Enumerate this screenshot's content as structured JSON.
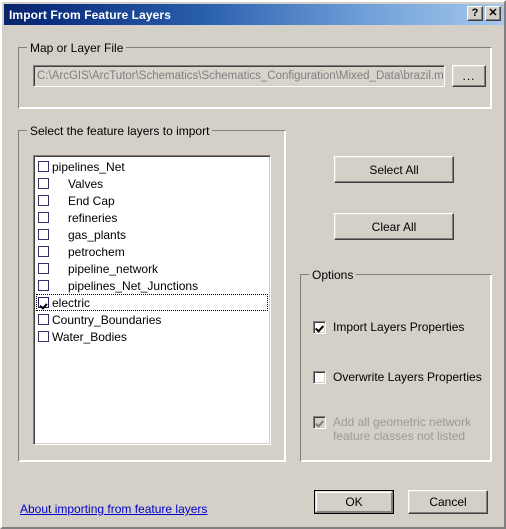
{
  "window": {
    "title": "Import From Feature Layers",
    "help_button": "?",
    "close_button": "✕"
  },
  "map_group": {
    "legend": "Map or Layer File",
    "path_value": "C:\\ArcGIS\\ArcTutor\\Schematics\\Schematics_Configuration\\Mixed_Data\\brazil.mxd",
    "browse_label": "..."
  },
  "layers_group": {
    "legend": "Select the feature layers to import",
    "items": [
      {
        "label": "pipelines_Net",
        "checked": false,
        "indent": false,
        "focused": false
      },
      {
        "label": "Valves",
        "checked": false,
        "indent": true,
        "focused": false
      },
      {
        "label": "End Cap",
        "checked": false,
        "indent": true,
        "focused": false
      },
      {
        "label": "refineries",
        "checked": false,
        "indent": true,
        "focused": false
      },
      {
        "label": "gas_plants",
        "checked": false,
        "indent": true,
        "focused": false
      },
      {
        "label": "petrochem",
        "checked": false,
        "indent": true,
        "focused": false
      },
      {
        "label": "pipeline_network",
        "checked": false,
        "indent": true,
        "focused": false
      },
      {
        "label": "pipelines_Net_Junctions",
        "checked": false,
        "indent": true,
        "focused": false
      },
      {
        "label": "electric",
        "checked": true,
        "indent": false,
        "focused": true
      },
      {
        "label": "Country_Boundaries",
        "checked": false,
        "indent": false,
        "focused": false
      },
      {
        "label": "Water_Bodies",
        "checked": false,
        "indent": false,
        "focused": false
      }
    ]
  },
  "side_buttons": {
    "select_all": "Select All",
    "clear_all": "Clear All"
  },
  "options_group": {
    "legend": "Options",
    "items": [
      {
        "label": "Import Layers Properties",
        "checked": true,
        "disabled": false
      },
      {
        "label": "Overwrite Layers Properties",
        "checked": false,
        "disabled": false
      },
      {
        "label": "Add all geometric network\nfeature classes not listed",
        "checked": true,
        "disabled": true
      }
    ]
  },
  "footer": {
    "help_link": "About importing from feature layers",
    "ok_label": "OK",
    "cancel_label": "Cancel"
  },
  "colors": {
    "dialog_face": "#d4d0c8",
    "title_start": "#0a246a",
    "title_end": "#a6c8ec",
    "link": "#0000cc",
    "disabled_text": "#808080"
  }
}
